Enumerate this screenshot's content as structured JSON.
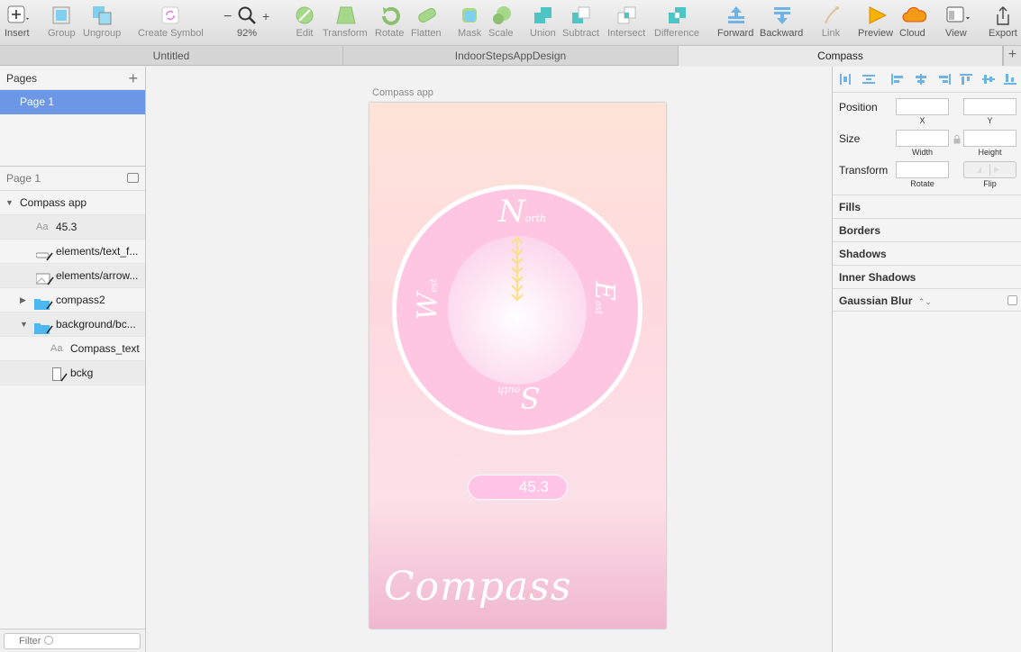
{
  "toolbar": {
    "insert": "Insert",
    "group": "Group",
    "ungroup": "Ungroup",
    "create_symbol": "Create Symbol",
    "zoom_minus": "−",
    "zoom_plus": "+",
    "zoom": "92%",
    "edit": "Edit",
    "transform": "Transform",
    "rotate": "Rotate",
    "flatten": "Flatten",
    "mask": "Mask",
    "scale": "Scale",
    "union": "Union",
    "subtract": "Subtract",
    "intersect": "Intersect",
    "difference": "Difference",
    "forward": "Forward",
    "backward": "Backward",
    "link": "Link",
    "preview": "Preview",
    "cloud": "Cloud",
    "view": "View",
    "export": "Export"
  },
  "tabs": [
    "Untitled",
    "IndoorStepsAppDesign",
    "Compass"
  ],
  "tab_add": "+",
  "pages": {
    "title": "Pages",
    "add": "+",
    "items": [
      "Page 1"
    ]
  },
  "layers": {
    "page_label": "Page 1",
    "items": [
      {
        "name": "Compass app"
      },
      {
        "name": "45.3",
        "icon_text": "Aa"
      },
      {
        "name": "elements/text_f..."
      },
      {
        "name": "elements/arrow..."
      },
      {
        "name": "compass2"
      },
      {
        "name": "background/bc..."
      },
      {
        "name": "Compass_text",
        "icon_text": "Aa"
      },
      {
        "name": "bckg"
      }
    ]
  },
  "filter": {
    "placeholder": "Filter"
  },
  "canvas": {
    "artboard_title": "Compass app",
    "directions": {
      "north": "North",
      "south": "South",
      "east": "East",
      "west": "West"
    },
    "readout": "45.3",
    "compass_text": "Compass"
  },
  "inspector": {
    "position_label": "Position",
    "x_label": "X",
    "y_label": "Y",
    "size_label": "Size",
    "width_label": "Width",
    "height_label": "Height",
    "transform_label": "Transform",
    "rotate_label": "Rotate",
    "flip_label": "Flip",
    "sections": [
      "Fills",
      "Borders",
      "Shadows",
      "Inner Shadows",
      "Gaussian Blur"
    ],
    "blur_stepper": "⌃⌄"
  },
  "colors": {
    "selection": "#6b97e6",
    "ring": "#ffc6e2",
    "accent_blue": "#6fb3e6",
    "arrow": "#f9e08f"
  }
}
